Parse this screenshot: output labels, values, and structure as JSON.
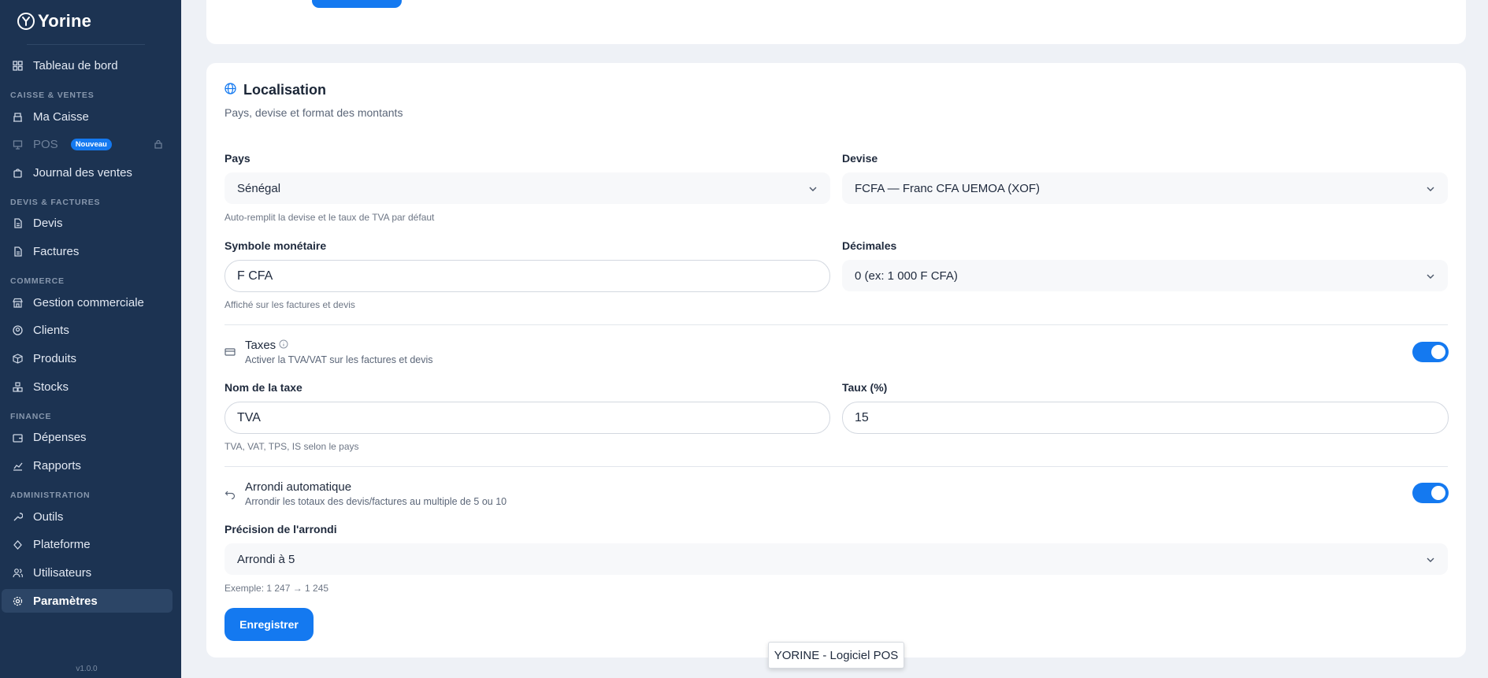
{
  "app": {
    "name": "Yorine",
    "version": "v1.0.0"
  },
  "sidebar": {
    "items": [
      {
        "label": "Tableau de bord",
        "icon": "dashboard-icon"
      },
      {
        "label": "Ma Caisse",
        "icon": "cash-register-icon"
      },
      {
        "label": "POS",
        "icon": "pos-icon",
        "badge": "Nouveau",
        "locked": true
      },
      {
        "label": "Journal des ventes",
        "icon": "shopping-bag-icon"
      },
      {
        "label": "Devis",
        "icon": "document-icon"
      },
      {
        "label": "Factures",
        "icon": "invoice-icon"
      },
      {
        "label": "Gestion commerciale",
        "icon": "store-icon"
      },
      {
        "label": "Clients",
        "icon": "user-circle-icon"
      },
      {
        "label": "Produits",
        "icon": "box-icon"
      },
      {
        "label": "Stocks",
        "icon": "stack-icon"
      },
      {
        "label": "Dépenses",
        "icon": "wallet-icon"
      },
      {
        "label": "Rapports",
        "icon": "chart-icon"
      },
      {
        "label": "Outils",
        "icon": "wrench-icon"
      },
      {
        "label": "Plateforme",
        "icon": "platform-icon"
      },
      {
        "label": "Utilisateurs",
        "icon": "users-icon"
      },
      {
        "label": "Paramètres",
        "icon": "gear-icon",
        "active": true
      }
    ],
    "sections": {
      "caisse": "CAISSE & VENTES",
      "devis": "DEVIS & FACTURES",
      "commerce": "COMMERCE",
      "finance": "FINANCE",
      "administration": "ADMINISTRATION"
    }
  },
  "localisation": {
    "title": "Localisation",
    "subtitle": "Pays, devise et format des montants",
    "pays": {
      "label": "Pays",
      "value": "Sénégal",
      "hint": "Auto-remplit la devise et le taux de TVA par défaut"
    },
    "devise": {
      "label": "Devise",
      "value": "FCFA — Franc CFA UEMOA (XOF)"
    },
    "symbole": {
      "label": "Symbole monétaire",
      "value": "F CFA",
      "hint": "Affiché sur les factures et devis"
    },
    "decimales": {
      "label": "Décimales",
      "value": "0 (ex: 1 000 F CFA)"
    },
    "taxes": {
      "title": "Taxes",
      "description": "Activer la TVA/VAT sur les factures et devis",
      "enabled": true
    },
    "nom_taxe": {
      "label": "Nom de la taxe",
      "value": "TVA",
      "hint": "TVA, VAT, TPS, IS selon le pays"
    },
    "taux": {
      "label": "Taux (%)",
      "value": "15"
    },
    "arrondi": {
      "title": "Arrondi automatique",
      "description": "Arrondir les totaux des devis/factures au multiple de 5 ou 10",
      "enabled": true
    },
    "precision": {
      "label": "Précision de l'arrondi",
      "value": "Arrondi à 5",
      "hint": "Exemple: 1 247 → 1 245"
    },
    "save_label": "Enregistrer"
  },
  "tooltip": "YORINE - Logiciel POS",
  "colors": {
    "sidebar_bg": "#1c3352",
    "accent": "#1479f0",
    "page_bg": "#eef1f6"
  }
}
